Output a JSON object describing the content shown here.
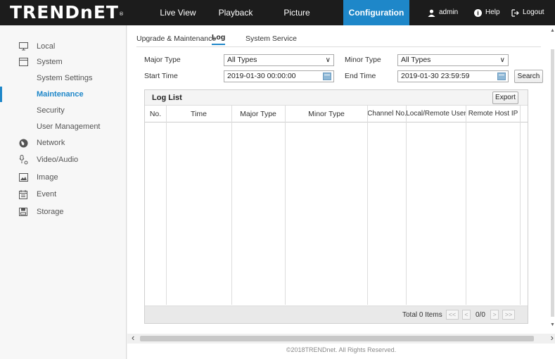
{
  "brand": {
    "logo": "TRENDnET",
    "trademark": "®"
  },
  "topnav": {
    "items": [
      {
        "label": "Live View"
      },
      {
        "label": "Playback"
      },
      {
        "label": "Picture"
      },
      {
        "label": "Configuration"
      }
    ],
    "user": "admin",
    "help": "Help",
    "logout": "Logout",
    "active_color": "#1e87c9"
  },
  "sidebar": {
    "items": [
      {
        "label": "Local",
        "icon": "monitor-icon"
      },
      {
        "label": "System",
        "icon": "system-icon"
      },
      {
        "label": "System Settings"
      },
      {
        "label": "Maintenance"
      },
      {
        "label": "Security"
      },
      {
        "label": "User Management"
      },
      {
        "label": "Network",
        "icon": "globe-icon"
      },
      {
        "label": "Video/Audio",
        "icon": "video-audio-icon"
      },
      {
        "label": "Image",
        "icon": "image-icon"
      },
      {
        "label": "Event",
        "icon": "event-icon"
      },
      {
        "label": "Storage",
        "icon": "storage-icon"
      }
    ]
  },
  "tabs": [
    {
      "label": "Upgrade & Maintenance"
    },
    {
      "label": "Log"
    },
    {
      "label": "System Service"
    }
  ],
  "filters": {
    "major_type_label": "Major Type",
    "major_type_value": "All Types",
    "minor_type_label": "Minor Type",
    "minor_type_value": "All Types",
    "start_time_label": "Start Time",
    "start_time_value": "2019-01-30 00:00:00",
    "end_time_label": "End Time",
    "end_time_value": "2019-01-30 23:59:59",
    "search_button": "Search"
  },
  "log_list": {
    "title": "Log List",
    "export_button": "Export",
    "columns": [
      "No.",
      "Time",
      "Major Type",
      "Minor Type",
      "Channel No.",
      "Local/Remote User",
      "Remote Host IP"
    ],
    "total": "Total 0 Items",
    "first": "<<",
    "prev": "<",
    "page": "0/0",
    "next": ">",
    "last": ">>"
  },
  "footer": {
    "copyright": "©2018TRENDnet. All Rights Reserved."
  }
}
